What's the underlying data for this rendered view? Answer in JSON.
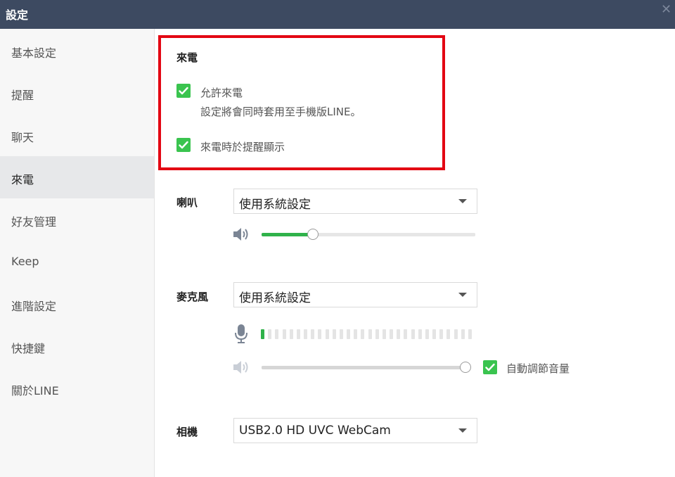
{
  "window": {
    "title": "設定",
    "close_icon": "close-icon"
  },
  "sidebar": {
    "items": [
      {
        "label": "基本設定"
      },
      {
        "label": "提醒"
      },
      {
        "label": "聊天"
      },
      {
        "label": "來電",
        "active": true
      },
      {
        "label": "好友管理"
      },
      {
        "label": "Keep"
      },
      {
        "label": "進階設定"
      },
      {
        "label": "快捷鍵"
      },
      {
        "label": "關於LINE"
      }
    ]
  },
  "calls": {
    "section_title": "來電",
    "allow_calls": {
      "checked": true,
      "label": "允許來電",
      "note": "設定將會同時套用至手機版LINE。"
    },
    "notify_on_call": {
      "checked": true,
      "label": "來電時於提醒顯示"
    }
  },
  "speaker": {
    "label": "喇叭",
    "selected": "使用系統設定",
    "volume_icon": "speaker-icon",
    "volume_percent": 24
  },
  "microphone": {
    "label": "麥克風",
    "selected": "使用系統設定",
    "mic_icon": "microphone-icon",
    "level_on_segments": 1,
    "level_total_segments": 30,
    "volume_icon": "speaker-muted-icon",
    "volume_percent": 100,
    "auto_adjust": {
      "checked": true,
      "label": "自動調節音量"
    }
  },
  "camera": {
    "label": "相機",
    "selected": "USB2.0 HD UVC WebCam"
  },
  "colors": {
    "titlebar": "#3d4a61",
    "accent_green": "#3ac44f",
    "highlight_red": "#e30613",
    "sidebar_bg": "#f7f7f7",
    "sidebar_active_bg": "#e7e8ea"
  }
}
